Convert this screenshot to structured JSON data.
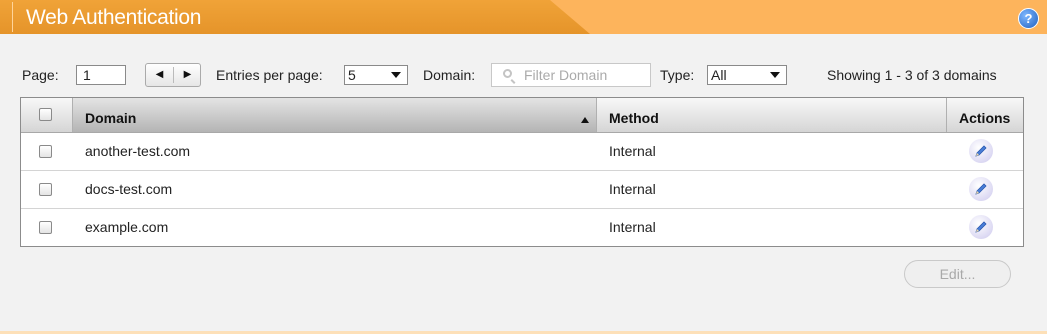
{
  "header": {
    "title": "Web Authentication",
    "help_label": "?"
  },
  "toolbar": {
    "page_label": "Page:",
    "page_value": "1",
    "prev_symbol": "◀",
    "next_symbol": "▶",
    "entries_label": "Entries per page:",
    "entries_value": "5",
    "domain_label": "Domain:",
    "domain_placeholder": "Filter Domain",
    "type_label": "Type:",
    "type_value": "All",
    "showing_text": "Showing 1 - 3 of 3 domains"
  },
  "table": {
    "columns": {
      "domain": "Domain",
      "method": "Method",
      "actions": "Actions"
    },
    "sort": {
      "column": "domain",
      "direction": "ascending"
    },
    "rows": [
      {
        "domain": "another-test.com",
        "method": "Internal"
      },
      {
        "domain": "docs-test.com",
        "method": "Internal"
      },
      {
        "domain": "example.com",
        "method": "Internal"
      }
    ]
  },
  "footer": {
    "edit_label": "Edit..."
  },
  "colors": {
    "header_orange": "#e5942a",
    "header_light": "#fdb45c",
    "background": "#f2f2f2"
  },
  "icons": {
    "help": "help-icon",
    "edit": "pencil-icon",
    "search": "search-icon"
  }
}
